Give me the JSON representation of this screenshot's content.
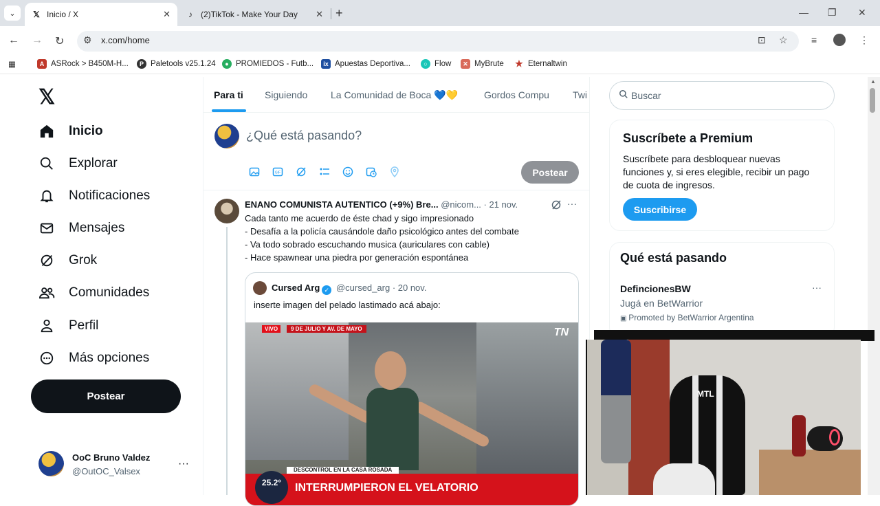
{
  "browser": {
    "tabs": [
      {
        "title": "Inicio / X",
        "active": true
      },
      {
        "title": "(2)TikTok - Make Your Day",
        "active": false
      }
    ],
    "url": "x.com/home",
    "bookmarks": [
      {
        "label": "ASRock > B450M-H...",
        "color": "#c0392b"
      },
      {
        "label": "Paletools v25.1.24",
        "color": "#333333"
      },
      {
        "label": "PROMIEDOS - Futb...",
        "color": "#27ae60"
      },
      {
        "label": "Apuestas Deportiva...",
        "color": "#1f4fa0"
      },
      {
        "label": "Flow",
        "color": "#19c6b7"
      },
      {
        "label": "MyBrute",
        "color": "#d96a5a"
      },
      {
        "label": "Eternaltwin",
        "color": "#c0392b"
      }
    ]
  },
  "sidebar": {
    "logo": "𝕏",
    "items": [
      {
        "label": "Inicio",
        "icon": "home-icon"
      },
      {
        "label": "Explorar",
        "icon": "search-icon"
      },
      {
        "label": "Notificaciones",
        "icon": "bell-icon"
      },
      {
        "label": "Mensajes",
        "icon": "mail-icon"
      },
      {
        "label": "Grok",
        "icon": "grok-icon"
      },
      {
        "label": "Comunidades",
        "icon": "people-icon"
      },
      {
        "label": "Perfil",
        "icon": "person-icon"
      },
      {
        "label": "Más opciones",
        "icon": "more-circle-icon"
      }
    ],
    "post_button": "Postear",
    "account": {
      "name": "OoC Bruno Valdez",
      "handle": "@OutOC_Valsex"
    }
  },
  "timeline": {
    "tabs": [
      "Para ti",
      "Siguiendo",
      "La Comunidad de Boca 💙💛",
      "Gordos Compu",
      "Twi"
    ],
    "compose_placeholder": "¿Qué está pasando?",
    "compose_post": "Postear",
    "tweet": {
      "name": "ENANO COMUNISTA AUTENTICO (+9%) Bre...",
      "handle": "@nicom...",
      "date": "· 21 nov.",
      "lines": [
        "Cada tanto me acuerdo de éste chad y sigo impresionado",
        "- Desafía a la policía causándole daño psicológico antes del combate",
        "- Va todo sobrado escuchando musica (auriculares con cable)",
        "- Hace spawnear una piedra por generación espontánea"
      ],
      "quote": {
        "name": "Cursed Arg",
        "handle": "@cursed_arg",
        "date": "· 20 nov.",
        "text": "inserte imagen del pelado lastimado acá abajo:",
        "media": {
          "live": "VIVO",
          "location": "9 DE JULIO Y AV. DE MAYO",
          "channel": "TN",
          "lower": "DESCONTROL EN LA CASA ROSADA",
          "headline": "INTERRUMPIERON EL VELATORIO",
          "temp": "25.2°"
        }
      }
    }
  },
  "right": {
    "search_placeholder": "Buscar",
    "premium": {
      "title": "Suscríbete a Premium",
      "lines": [
        "Suscríbete para desbloquear nuevas",
        "funciones y, si eres elegible, recibir un pago",
        "de cuota de ingresos."
      ],
      "button": "Suscribirse"
    },
    "trends": {
      "title": "Qué está pasando",
      "name": "DefincionesBW",
      "sub": "Jugá en BetWarrior",
      "promo": "Promoted by BetWarrior Argentina"
    }
  },
  "webcam": {
    "chair_label": "MTL"
  },
  "colors": {
    "accent": "#1d9bf0",
    "text": "#0f1419",
    "muted": "#536471"
  }
}
